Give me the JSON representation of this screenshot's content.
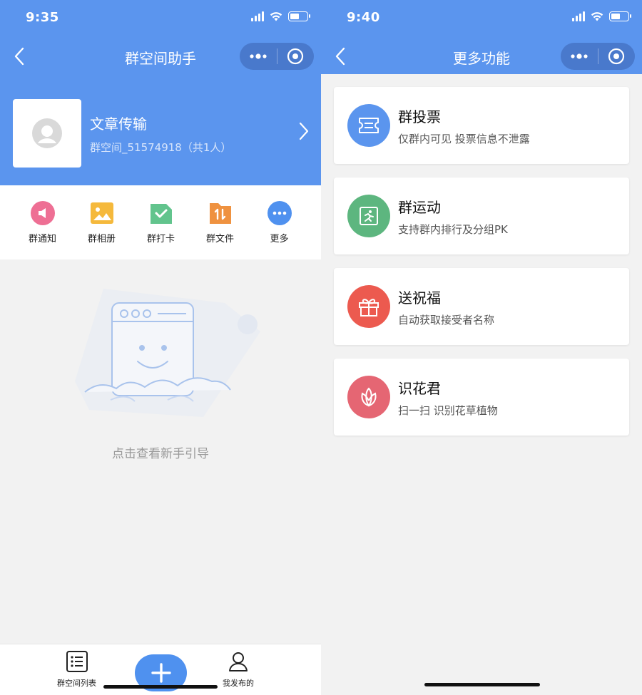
{
  "left": {
    "status": {
      "time": "9:35"
    },
    "nav": {
      "title": "群空间助手"
    },
    "profile": {
      "name": "文章传输",
      "subtitle": "群空间_51574918（共1人）"
    },
    "functions": [
      {
        "label": "群通知",
        "icon": "megaphone-icon",
        "color": "#ee6f94"
      },
      {
        "label": "群相册",
        "icon": "photo-icon",
        "color": "#f5b93c"
      },
      {
        "label": "群打卡",
        "icon": "checkin-icon",
        "color": "#62c48d"
      },
      {
        "label": "群文件",
        "icon": "file-icon",
        "color": "#ef9240"
      },
      {
        "label": "更多",
        "icon": "more-icon",
        "color": "#4f91ef"
      }
    ],
    "guide": {
      "text": "点击查看新手引导"
    },
    "tabbar": {
      "list_label": "群空间列表",
      "mine_label": "我发布的"
    }
  },
  "right": {
    "status": {
      "time": "9:40"
    },
    "nav": {
      "title": "更多功能"
    },
    "cards": [
      {
        "title": "群投票",
        "desc": "仅群内可见 投票信息不泄露",
        "icon": "ticket-icon",
        "color": "#5b95ee"
      },
      {
        "title": "群运动",
        "desc": "支持群内排行及分组PK",
        "icon": "running-icon",
        "color": "#5db67f"
      },
      {
        "title": "送祝福",
        "desc": "自动获取接受者名称",
        "icon": "gift-icon",
        "color": "#ec5a4f"
      },
      {
        "title": "识花君",
        "desc": "扫一扫 识别花草植物",
        "icon": "flower-icon",
        "color": "#e56673"
      }
    ]
  },
  "colors": {
    "primary": "#5b95ee",
    "background": "#f2f2f2"
  }
}
